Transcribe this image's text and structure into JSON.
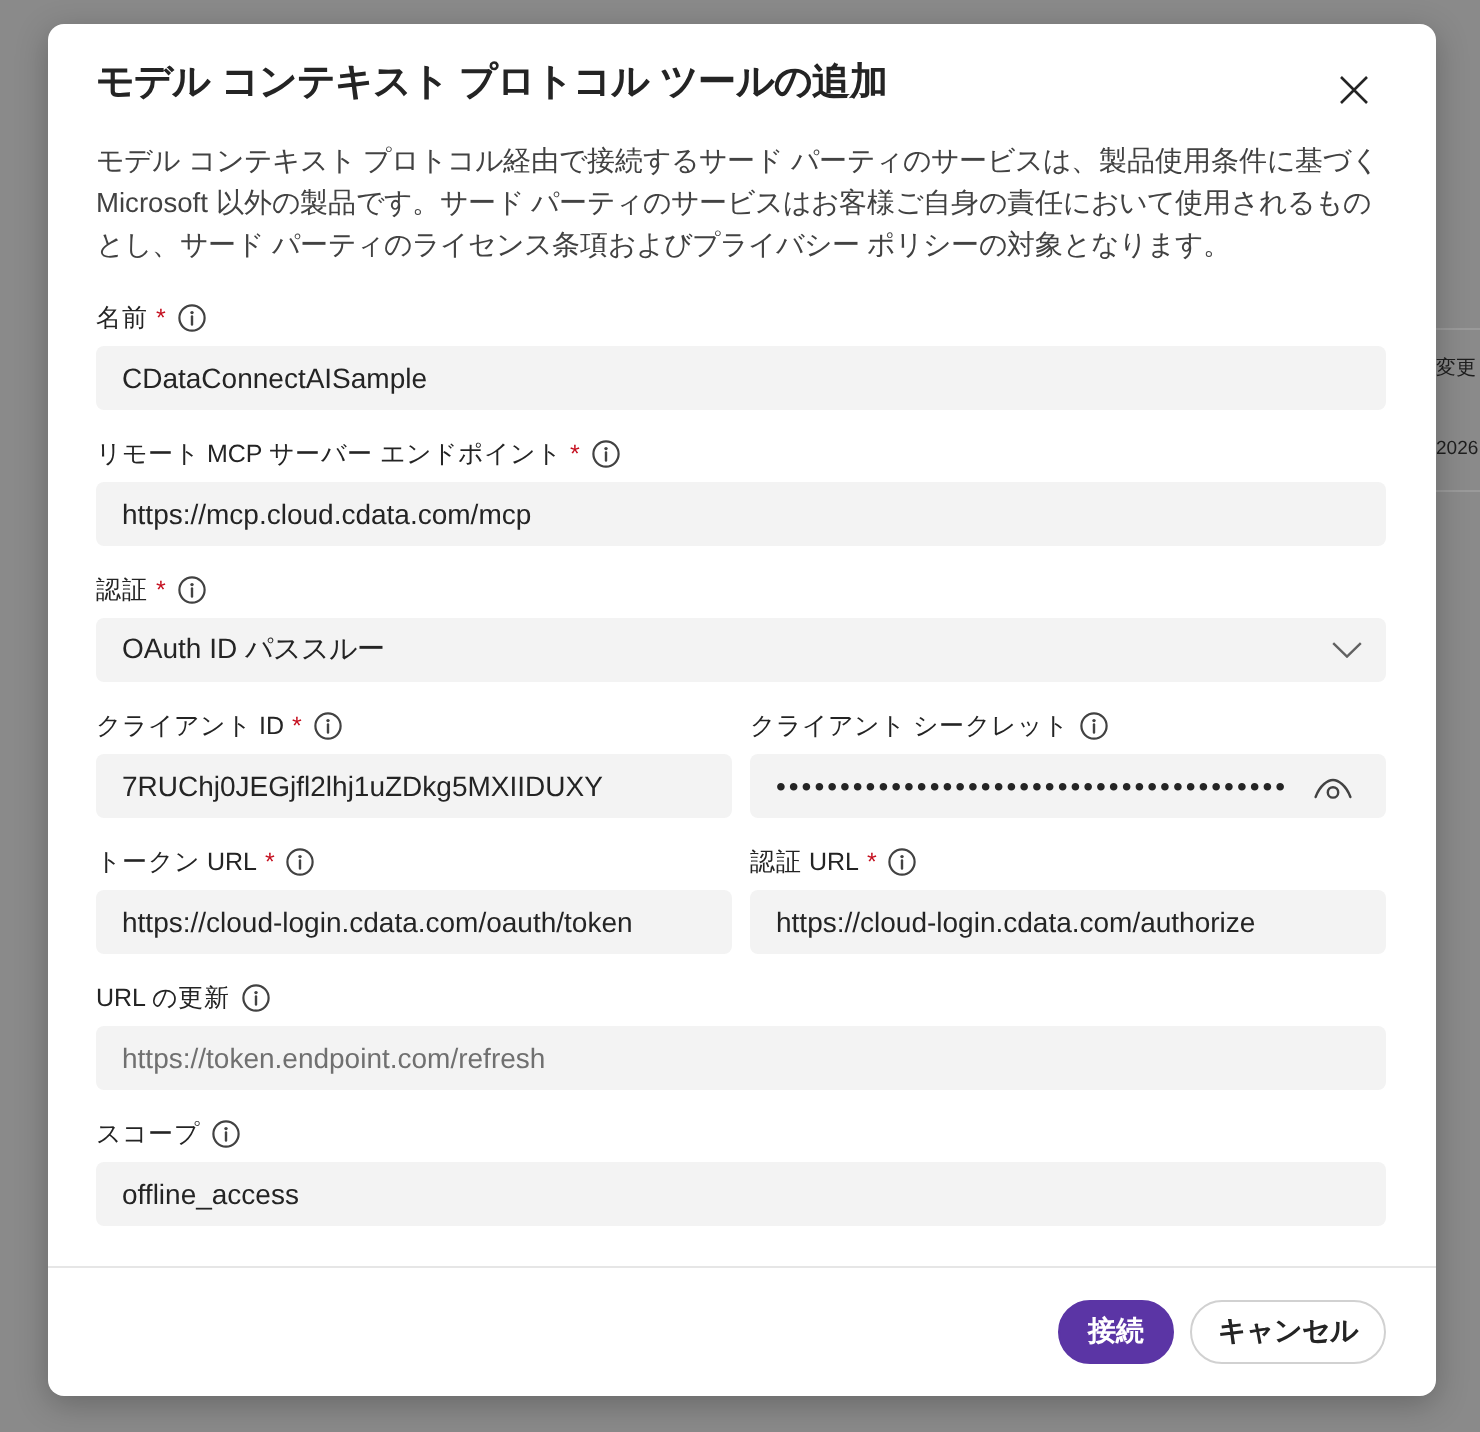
{
  "background": {
    "texts": [
      "変更",
      "2026"
    ]
  },
  "dialog": {
    "title": "モデル コンテキスト プロトコル ツールの追加",
    "description": "モデル コンテキスト プロトコル経由で接続するサード パーティのサービスは、製品使用条件に基づく Microsoft 以外の製品です。サード パーティのサービスはお客様ご自身の責任において使用されるものとし、サード パーティのライセンス条項およびプライバシー ポリシーの対象となります。",
    "rows": [
      [
        {
          "label": "名前",
          "required_mark": "*",
          "kind": "text",
          "value": "CDataConnectAISample"
        }
      ],
      [
        {
          "label": "リモート MCP サーバー エンドポイント",
          "required_mark": "*",
          "kind": "text",
          "value": "https://mcp.cloud.cdata.com/mcp"
        }
      ],
      [
        {
          "label": "認証",
          "required_mark": "*",
          "kind": "select",
          "value": "OAuth ID パススルー"
        }
      ],
      [
        {
          "label": "クライアント ID",
          "required_mark": "*",
          "kind": "text",
          "value": "7RUChj0JEGjfl2lhj1uZDkg5MXIIDUXY"
        },
        {
          "label": "クライアント シークレット",
          "kind": "password",
          "value": "••••••••••••••••••••••••••••••••••••••••"
        }
      ],
      [
        {
          "label": "トークン URL",
          "required_mark": "*",
          "kind": "text",
          "value": "https://cloud-login.cdata.com/oauth/token"
        },
        {
          "label": "認証 URL",
          "required_mark": "*",
          "kind": "text",
          "value": "https://cloud-login.cdata.com/authorize"
        }
      ],
      [
        {
          "label": "URL の更新",
          "kind": "text",
          "placeholder": "https://token.endpoint.com/refresh"
        }
      ],
      [
        {
          "label": "スコープ",
          "kind": "text",
          "value": "offline_access"
        }
      ]
    ],
    "buttons": [
      {
        "label": "接続",
        "kind": "primary"
      },
      {
        "label": "キャンセル",
        "kind": "secondary"
      }
    ]
  }
}
